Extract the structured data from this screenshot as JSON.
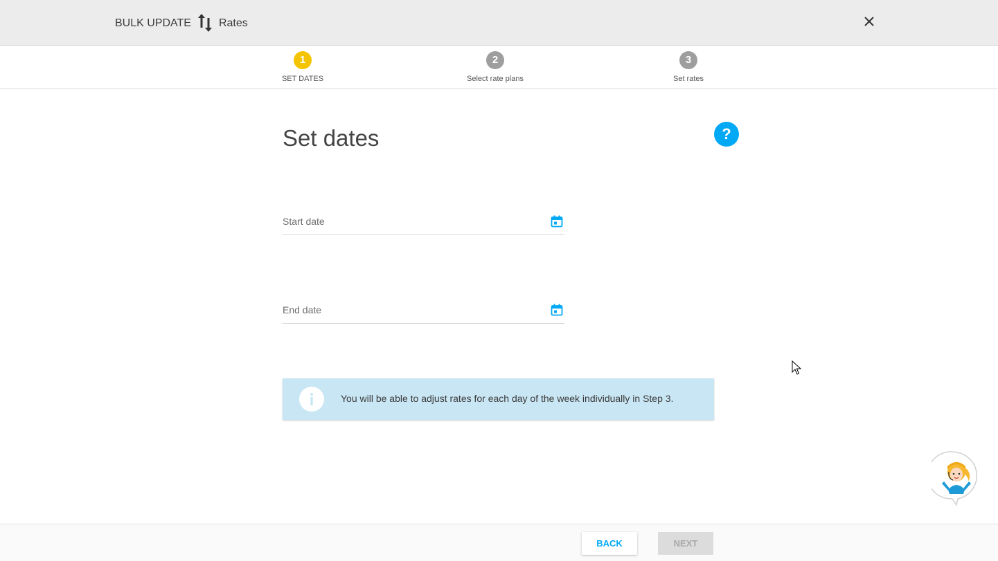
{
  "header": {
    "title": "BULK UPDATE",
    "subtitle": "Rates",
    "icons": {
      "arrows": "swap-vertical-icon",
      "close": "close-icon"
    }
  },
  "steps": [
    {
      "number": "1",
      "label": "SET DATES",
      "state": "active",
      "color": "#f5c400"
    },
    {
      "number": "2",
      "label": "Select rate plans",
      "state": "inactive",
      "color": "#9e9e9e"
    },
    {
      "number": "3",
      "label": "Set rates",
      "state": "inactive",
      "color": "#9e9e9e"
    }
  ],
  "main": {
    "heading": "Set dates",
    "help_label": "?",
    "start_date": {
      "placeholder": "Start date",
      "value": ""
    },
    "end_date": {
      "placeholder": "End date",
      "value": ""
    },
    "info_text": "You will be able to adjust rates for each day of the week individually in Step 3."
  },
  "footer": {
    "back_label": "BACK",
    "next_label": "NEXT",
    "next_enabled": false
  },
  "colors": {
    "accent": "#03a9f4",
    "active_step": "#f5c400",
    "inactive_step": "#9e9e9e",
    "info_bg": "#c9e6f4"
  }
}
